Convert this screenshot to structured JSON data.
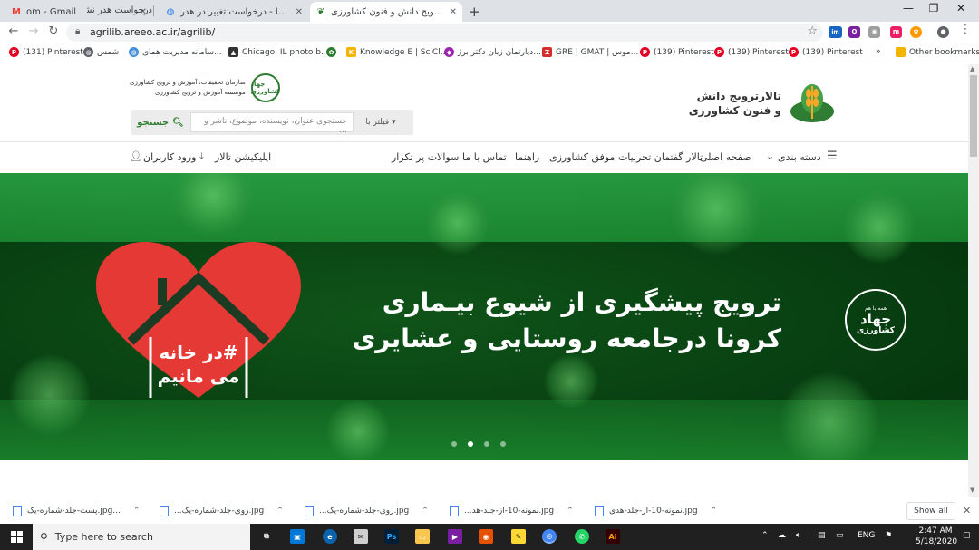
{
  "browser": {
    "tabs": [
      {
        "label": "om - Gmail",
        "icon": "gmail-icon",
        "active": false
      },
      {
        "label": "درخواست هدر نشریه -",
        "icon": "doc-icon",
        "active": false
      },
      {
        "label": "تیکت ها - درخواست تغییر در هدر ...",
        "icon": "globe-icon",
        "active": false
      },
      {
        "label": "تالار ترویج دانش و فنون کشاورزی",
        "icon": "site-icon",
        "active": true
      }
    ],
    "url": "agrilib.areeo.ac.ir/agrilib/",
    "bookmarks": [
      {
        "label": "(131) Pinterest",
        "color": "#e60023"
      },
      {
        "label": "شمس",
        "color": "#5f6368"
      },
      {
        "label": "سامانه مدیریت همای...",
        "color": "#4a90d9"
      },
      {
        "label": "Chicago, IL photo b...",
        "color": "#333333"
      },
      {
        "label": "",
        "color": "#2e7d32"
      },
      {
        "label": "Knowledge E | SciCl...",
        "color": "#f4b400"
      },
      {
        "label": "دیارتمان زبان دکتر برژ...",
        "color": "#9c27b0"
      },
      {
        "label": "GRE | GMAT | موس...",
        "color": "#d32f2f"
      },
      {
        "label": "(139) Pinterest",
        "color": "#e60023"
      },
      {
        "label": "(139) Pinterest",
        "color": "#e60023"
      },
      {
        "label": "(139) Pinterest",
        "color": "#e60023"
      }
    ],
    "more_bookmarks": "»",
    "other_bookmarks": "Other bookmarks"
  },
  "site": {
    "title_line1": "تالارترویج دانش",
    "title_line2": "و فنون کشاورزی",
    "org_line1": "سازمان تحقیقات، آموزش و ترویج کشاورزی",
    "org_line2": "موسسه آموزش و ترویج کشاورزی",
    "org_seal": "جهاد کشاورزی",
    "search_button": "جستجو",
    "search_placeholder": "جستجوی عنوان، نویسنده، موضوع، ناشر و ...",
    "filter_label": "فیلتر با",
    "nav": {
      "categories": "دسته بندی",
      "home": "صفحه اصلی",
      "forum": "تالار گفتمان تجربیات موفق کشاورزی",
      "guide": "راهنما",
      "contact": "تماس با ما",
      "faq": "سوالات پر تکرار",
      "app": "اپلیکیشن تالار",
      "login": "ورود کاربران"
    }
  },
  "hero": {
    "title_line1": "ترویج پیشگیری از شیوع بیـماری",
    "title_line2": "کرونا درجامعه روستایی و عشایری",
    "heart_line1": "#در خانه",
    "heart_line2": "می مانیم",
    "seal_top": "همه با هم",
    "seal_main": "جهاد",
    "seal_sub": "کشاورزی",
    "slides": 4,
    "active_slide": 1
  },
  "downloads": {
    "items": [
      "پست-جلد-شماره-یک.jpg...",
      "...روی-جلد-شماره-یک.jpg",
      "...روی-جلد-شماره-یک.jpg",
      "...نمونه-10-از-جلد-هد.jpg",
      "نمونه-10-از-جلد-هدی.jpg"
    ],
    "show_all": "Show all"
  },
  "taskbar": {
    "search_placeholder": "Type here to search",
    "lang": "ENG",
    "time": "2:47 AM",
    "date": "5/18/2020"
  }
}
